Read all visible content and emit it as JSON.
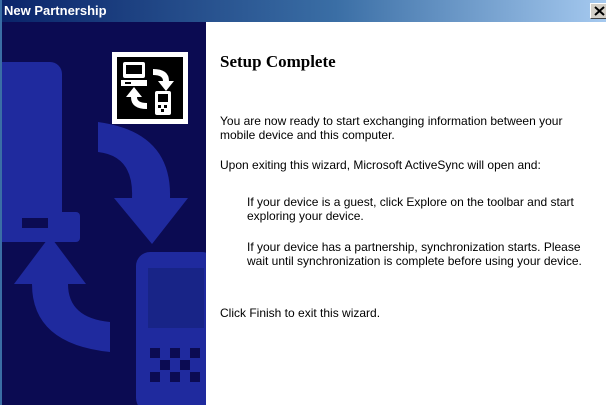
{
  "window": {
    "title": "New Partnership",
    "close_icon": "close-x-icon"
  },
  "sidebar": {
    "icon": "activesync-wizard-icon"
  },
  "content": {
    "heading": "Setup Complete",
    "paragraph_1": "You are now ready to start exchanging information between your mobile device and this computer.",
    "paragraph_2": "Upon exiting this wizard, Microsoft ActiveSync will open and:",
    "indent_1": "If your device is a guest, click Explore on the toolbar and start exploring your device.",
    "indent_2": "If your device has a partnership, synchronization starts. Please wait until synchronization is complete before using your device.",
    "paragraph_3": "Click Finish to exit this wizard."
  },
  "colors": {
    "titlebar_start": "#0a246a",
    "titlebar_end": "#a6caf0",
    "sidebar_bg": "#0b0b52",
    "sidebar_shapes": "#1f2a9e"
  }
}
